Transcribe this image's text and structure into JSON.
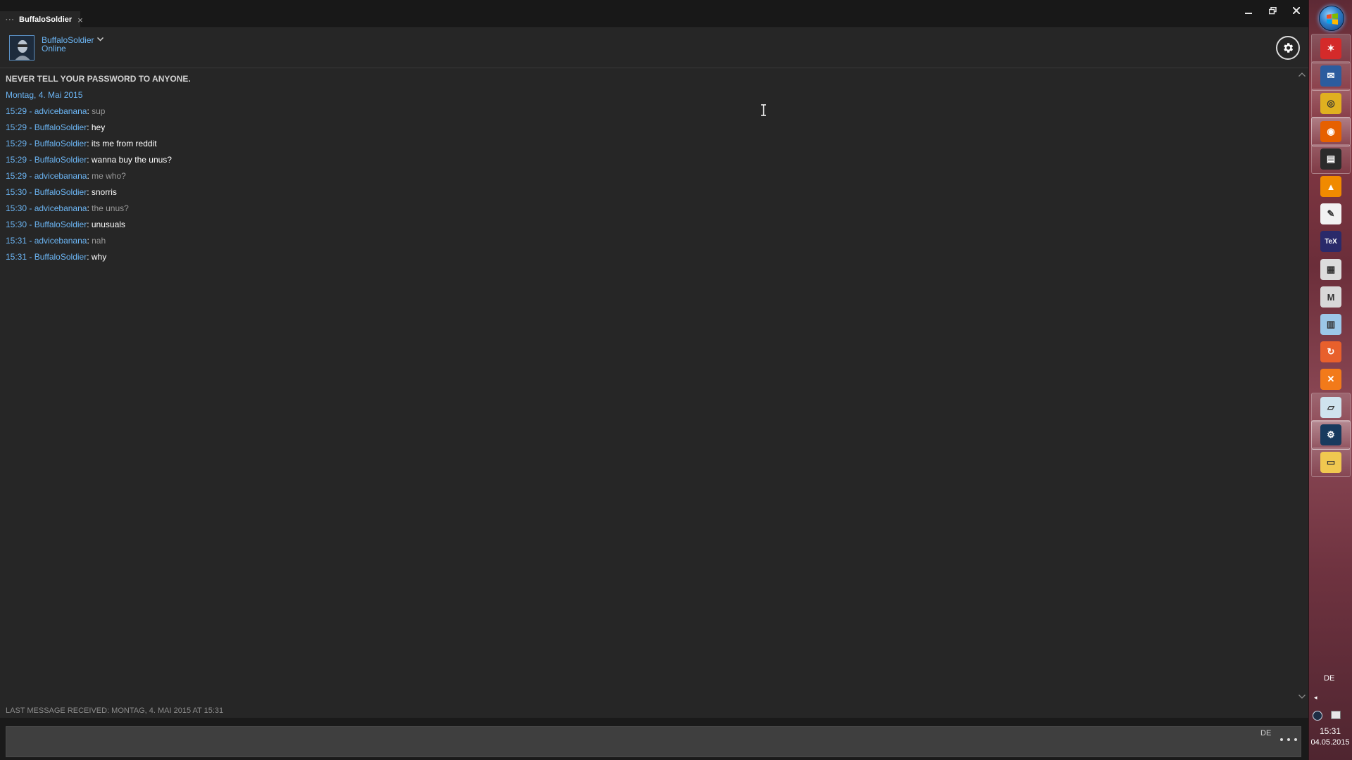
{
  "window": {
    "tab_label": "BuffaloSoldier",
    "tab_dots": "···",
    "tab_close": "×"
  },
  "friend": {
    "name": "BuffaloSoldier",
    "status": "Online"
  },
  "chat": {
    "warning": "NEVER TELL YOUR PASSWORD TO ANYONE.",
    "date_header": "Montag, 4. Mai 2015",
    "messages": [
      {
        "time": "15:29",
        "sender": "advicebanana",
        "text": "sup",
        "self": false
      },
      {
        "time": "15:29",
        "sender": "BuffaloSoldier",
        "text": "hey",
        "self": true
      },
      {
        "time": "15:29",
        "sender": "BuffaloSoldier",
        "text": "its me from reddit",
        "self": true
      },
      {
        "time": "15:29",
        "sender": "BuffaloSoldier",
        "text": "wanna buy the unus?",
        "self": true
      },
      {
        "time": "15:29",
        "sender": "advicebanana",
        "text": "me who?",
        "self": false
      },
      {
        "time": "15:30",
        "sender": "BuffaloSoldier",
        "text": "snorris",
        "self": true
      },
      {
        "time": "15:30",
        "sender": "advicebanana",
        "text": "the unus?",
        "self": false
      },
      {
        "time": "15:30",
        "sender": "BuffaloSoldier",
        "text": "unusuals",
        "self": true
      },
      {
        "time": "15:31",
        "sender": "advicebanana",
        "text": "nah",
        "self": false
      },
      {
        "time": "15:31",
        "sender": "BuffaloSoldier",
        "text": "why",
        "self": true
      }
    ],
    "last_received": "LAST MESSAGE RECEIVED: MONTAG, 4. MAI 2015 AT 15:31",
    "input_value": "",
    "input_language": "DE"
  },
  "taskbar": {
    "items": [
      {
        "name": "app-red-star-icon",
        "color": "#d42a2a",
        "glyph": "✶",
        "state": "open"
      },
      {
        "name": "thunderbird-icon",
        "color": "#2c5c9e",
        "glyph": "✉",
        "state": "open"
      },
      {
        "name": "chrome-icon",
        "color": "#e0b020",
        "glyph": "◎",
        "state": "open"
      },
      {
        "name": "firefox-icon",
        "color": "#e66000",
        "glyph": "◉",
        "state": "active"
      },
      {
        "name": "terminal-icon",
        "color": "#2b2b2b",
        "glyph": "▤",
        "state": "open"
      },
      {
        "name": "vlc-icon",
        "color": "#f08a00",
        "glyph": "▲",
        "state": "none"
      },
      {
        "name": "text-editor-icon",
        "color": "#f2f2f2",
        "glyph": "✎",
        "state": "none"
      },
      {
        "name": "tex-icon",
        "color": "#2a2a6a",
        "glyph": "TeX",
        "state": "none"
      },
      {
        "name": "hex-editor-icon",
        "color": "#dcdcdc",
        "glyph": "▦",
        "state": "none"
      },
      {
        "name": "maple-icon",
        "color": "#d8d8d8",
        "glyph": "M",
        "state": "none"
      },
      {
        "name": "calculator-icon",
        "color": "#9cc7e8",
        "glyph": "▥",
        "state": "none"
      },
      {
        "name": "sync-icon",
        "color": "#e8602c",
        "glyph": "↻",
        "state": "none"
      },
      {
        "name": "xampp-icon",
        "color": "#f27a1a",
        "glyph": "✕",
        "state": "none"
      },
      {
        "name": "blank-document-icon",
        "color": "#cfe3ee",
        "glyph": "▱",
        "state": "open"
      },
      {
        "name": "steam-icon",
        "color": "#173a5e",
        "glyph": "⚙",
        "state": "active"
      },
      {
        "name": "file-explorer-icon",
        "color": "#f0c850",
        "glyph": "▭",
        "state": "open"
      }
    ],
    "tray_language": "DE",
    "tray_expand": "◂",
    "clock_time": "15:31",
    "clock_date": "04.05.2015"
  }
}
